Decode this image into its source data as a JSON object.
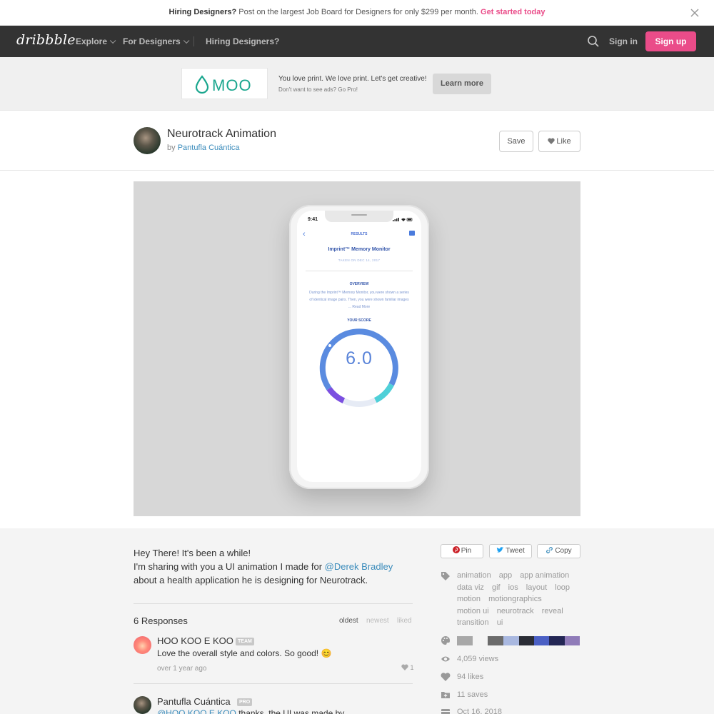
{
  "promo": {
    "bold": "Hiring Designers?",
    "text": " Post on the largest Job Board for Designers for only $299 per month. ",
    "cta": "Get started today"
  },
  "nav": {
    "logo": "dribbble",
    "explore": "Explore",
    "for_designers": "For Designers",
    "hiring": "Hiring Designers?",
    "sign_in": "Sign in",
    "sign_up": "Sign up"
  },
  "ad": {
    "brand": "MOO",
    "line1": "You love print. We love print. Let's get creative!",
    "line2": "Don't want to see ads? Go Pro!",
    "button": "Learn more",
    "brand_color": "#1aa68e"
  },
  "shot": {
    "title": "Neurotrack Animation",
    "by": "by",
    "author": "Pantufla Cuántica",
    "save": "Save",
    "like": "Like"
  },
  "phone": {
    "time": "9:41",
    "header": "RESULTS",
    "title": "Imprint™ Memory Monitor",
    "taken": "TAKEN ON DEC 14, 2017",
    "overview": "OVERVIEW",
    "body": "During the Imprint™ Memory Monitor, you were shown a series of identical image pairs. Then, you were shown familiar images ... Read More",
    "score_label": "YOUR SCORE",
    "score": "6.0"
  },
  "description": {
    "line1": "Hey There! It's been a while!",
    "line2": "I'm sharing with you a UI animation I made for ",
    "mention": "@Derek Bradley",
    "line3": "about a health application he is designing for Neurotrack."
  },
  "responses": {
    "heading": "6 Responses",
    "sort": [
      "oldest",
      "newest",
      "liked"
    ],
    "comments": [
      {
        "name": "HOO KOO E KOO",
        "badge": "TEAM",
        "text": "Love the overall style and colors. So good! 😊",
        "time": "over 1 year ago",
        "likes": "1"
      },
      {
        "name": "Pantufla Cuántica",
        "badge": "PRO",
        "mention": "@HOO KOO E KOO",
        "text": " thanks, the UI was made by"
      }
    ]
  },
  "share": {
    "pin": "Pin",
    "tweet": "Tweet",
    "copy": "Copy"
  },
  "tags": [
    "animation",
    "app",
    "app animation",
    "data viz",
    "gif",
    "ios",
    "layout",
    "loop",
    "motion",
    "motiongraphics",
    "motion ui",
    "neurotrack",
    "reveal",
    "transition",
    "ui"
  ],
  "palette": [
    "#a8a8a8",
    "#f4f4f4",
    "#6b6b6b",
    "#a9b8e0",
    "#2a2c35",
    "#4a5fc4",
    "#232654",
    "#8f7bb8"
  ],
  "stats": {
    "views": "4,059 views",
    "likes": "94 likes",
    "saves": "11 saves",
    "date": "Oct 16, 2018"
  },
  "colors": {
    "accent": "#ea4c89",
    "link": "#3a8bbb",
    "nav_bg": "#333333"
  }
}
